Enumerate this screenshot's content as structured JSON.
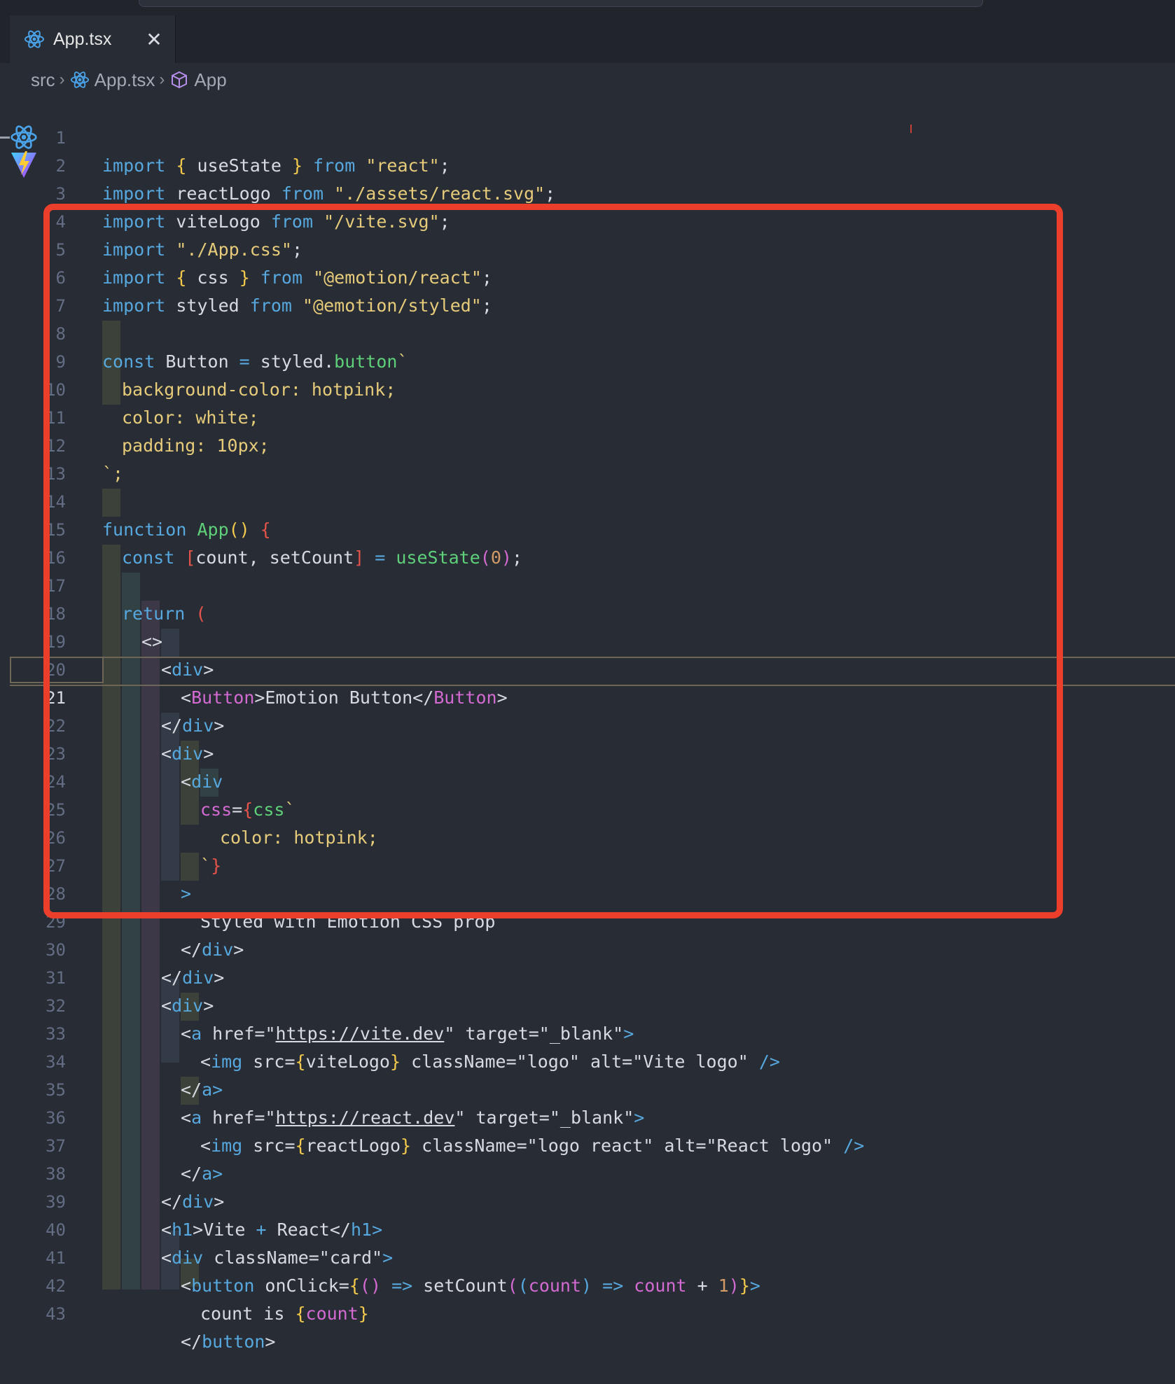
{
  "tab": {
    "label": "App.tsx",
    "close": "✕"
  },
  "breadcrumb": {
    "part1": "src",
    "part2": "App.tsx",
    "part3": "App"
  },
  "lines": [
    {
      "n": "1"
    },
    {
      "n": "2"
    },
    {
      "n": "3"
    },
    {
      "n": "4"
    },
    {
      "n": "5"
    },
    {
      "n": "6"
    },
    {
      "n": "7"
    },
    {
      "n": "8"
    },
    {
      "n": "9"
    },
    {
      "n": "10"
    },
    {
      "n": "11"
    },
    {
      "n": "12"
    },
    {
      "n": "13"
    },
    {
      "n": "14"
    },
    {
      "n": "15"
    },
    {
      "n": "16"
    },
    {
      "n": "17"
    },
    {
      "n": "18"
    },
    {
      "n": "19"
    },
    {
      "n": "20"
    },
    {
      "n": "21"
    },
    {
      "n": "22"
    },
    {
      "n": "23"
    },
    {
      "n": "24"
    },
    {
      "n": "25"
    },
    {
      "n": "26"
    },
    {
      "n": "27"
    },
    {
      "n": "28"
    },
    {
      "n": "29"
    },
    {
      "n": "30"
    },
    {
      "n": "31"
    },
    {
      "n": "32"
    },
    {
      "n": "33"
    },
    {
      "n": "34"
    },
    {
      "n": "35"
    },
    {
      "n": "36"
    },
    {
      "n": "37"
    },
    {
      "n": "38"
    },
    {
      "n": "39"
    },
    {
      "n": "40"
    },
    {
      "n": "41"
    },
    {
      "n": "42"
    },
    {
      "n": "43"
    }
  ],
  "code": {
    "l1": {
      "a": "import ",
      "b": "{ ",
      "c": "useState ",
      "d": "} ",
      "e": "from ",
      "f": "\"react\"",
      ";": ";"
    },
    "l2": {
      "a": "import ",
      "b": "reactLogo ",
      "c": "from ",
      "d": "\"./assets/react.svg\"",
      "e": ";"
    },
    "l3": {
      "a": "import ",
      "b": "viteLogo ",
      "c": "from ",
      "d": "\"/vite.svg\"",
      "e": ";"
    },
    "l4": {
      "a": "import ",
      "b": "\"./App.css\"",
      "c": ";"
    },
    "l5": {
      "a": "import ",
      "b": "{ ",
      "c": "css ",
      "d": "} ",
      "e": "from ",
      "f": "\"@emotion/react\"",
      "g": ";"
    },
    "l6": {
      "a": "import ",
      "b": "styled ",
      "c": "from ",
      "d": "\"@emotion/styled\"",
      "e": ";"
    },
    "l8": {
      "a": "const ",
      "b": "Button ",
      "c": "= ",
      "d": "styled.",
      "e": "button",
      "f": "`"
    },
    "l9": "background-color: hotpink;",
    "l10": "color: white;",
    "l11": "padding: 10px;",
    "l12": "`;",
    "l14": {
      "a": "function ",
      "b": "App",
      "c": "() ",
      "d": "{"
    },
    "l15": {
      "a": "const ",
      "b": "[",
      "c": "count, setCount",
      "d": "] ",
      "e": "= ",
      "f": "useState",
      "g": "(",
      "h": "0",
      "i": ")",
      "j": ";"
    },
    "l17": {
      "a": "return ",
      "b": "("
    },
    "l18": "<>",
    "l19": {
      "a": "<",
      "b": "div",
      "c": ">"
    },
    "l20": {
      "a": "<",
      "b": "Button",
      "c": ">Emotion Button</",
      "d": "Button",
      "e": ">"
    },
    "l21": {
      "a": "</",
      "b": "div",
      "c": ">"
    },
    "l22": {
      "a": "<",
      "b": "div",
      "c": ">"
    },
    "l23": {
      "a": "<",
      "b": "div"
    },
    "l24": {
      "a": "css",
      "b": "=",
      "c": "{",
      "d": "css",
      "e": "`"
    },
    "l25": "color: hotpink;",
    "l26": {
      "a": "`",
      "b": "}"
    },
    "l27": ">",
    "l28": "Styled with Emotion CSS prop",
    "l29": {
      "a": "</",
      "b": "div",
      "c": ">"
    },
    "l30": {
      "a": "</",
      "b": "div",
      "c": ">"
    },
    "l31": {
      "a": "<",
      "b": "div",
      "c": ">"
    },
    "l32": {
      "a": "<",
      "b": "a ",
      "c": "href",
      "d": "=\"",
      "e": "https://vite.dev",
      "f": "\" ",
      "g": "target",
      "h": "=\"_blank\"",
      "i": ">"
    },
    "l33": {
      "a": "<",
      "b": "img ",
      "c": "src",
      "d": "=",
      "e": "{",
      "f": "viteLogo",
      "g": "} ",
      "h": "className",
      "i": "=\"logo\" ",
      "j": "alt",
      "k": "=\"Vite logo\" ",
      "l": "/>"
    },
    "l34": {
      "a": "</",
      "b": "a",
      "c": ">"
    },
    "l35": {
      "a": "<",
      "b": "a ",
      "c": "href",
      "d": "=\"",
      "e": "https://react.dev",
      "f": "\" ",
      "g": "target",
      "h": "=\"_blank\"",
      "i": ">"
    },
    "l36": {
      "a": "<",
      "b": "img ",
      "c": "src",
      "d": "=",
      "e": "{",
      "f": "reactLogo",
      "g": "} ",
      "h": "className",
      "i": "=\"logo react\" ",
      "j": "alt",
      "k": "=\"React logo\" ",
      "l": "/>"
    },
    "l37": {
      "a": "</",
      "b": "a",
      "c": ">"
    },
    "l38": {
      "a": "</",
      "b": "div",
      "c": ">"
    },
    "l39": {
      "a": "<",
      "b": "h1",
      "c": ">Vite ",
      "d": "+ ",
      "e": "React</",
      "f": "h1",
      "g": ">"
    },
    "l40": {
      "a": "<",
      "b": "div ",
      "c": "className",
      "d": "=\"card\"",
      "e": ">"
    },
    "l41": {
      "a": "<",
      "b": "button ",
      "c": "onClick",
      "d": "=",
      "e": "{",
      "f": "() ",
      "g": "=> ",
      "h": "setCount",
      "i": "(",
      "j": "(",
      "k": "count",
      "l": ") ",
      "m": "=> ",
      "n": "count ",
      "o": "+ ",
      "p": "1",
      "q": ")",
      "r": "}",
      "s": ">"
    },
    "l42": {
      "a": "count is ",
      "b": "{",
      "c": "count",
      "d": "}"
    },
    "l43": {
      "a": "</",
      "b": "button",
      "c": ">"
    }
  },
  "colors": {
    "highlight": "#ec3f2b",
    "background": "#282c34"
  },
  "icons": {
    "tab": "react-icon",
    "breadcrumb_file": "react-icon",
    "breadcrumb_symbol": "cube-icon"
  }
}
